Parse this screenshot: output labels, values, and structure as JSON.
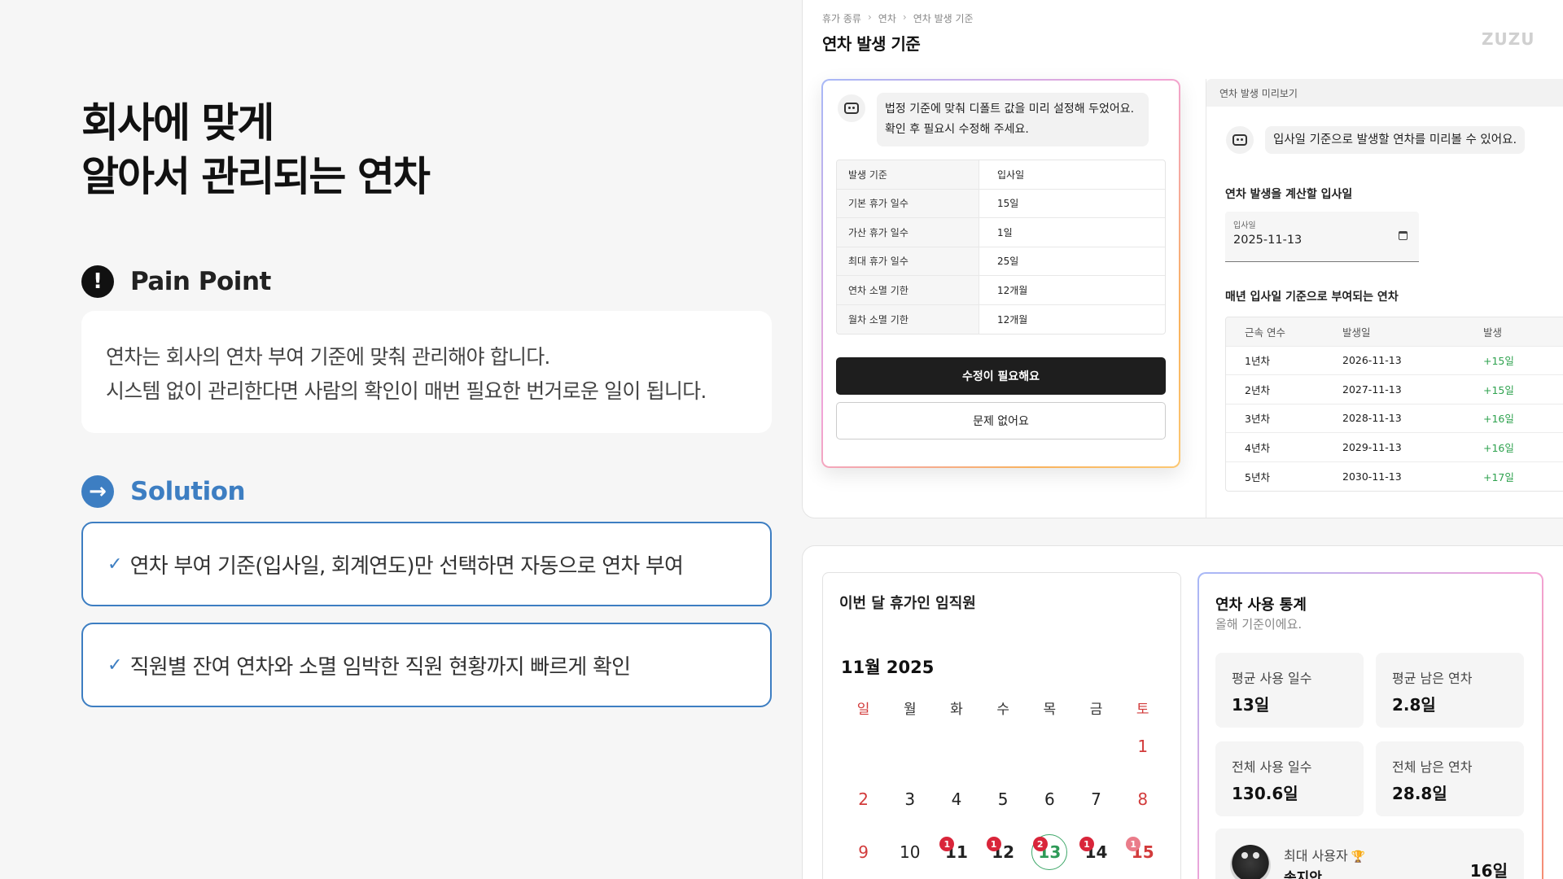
{
  "left": {
    "headline_line1": "회사에 맞게",
    "headline_line2": "알아서 관리되는 연차",
    "pain": {
      "icon": "exclamation-icon",
      "title": "Pain Point",
      "line1": "연차는 회사의 연차 부여 기준에 맞춰 관리해야 합니다.",
      "line2": "시스템 없이 관리한다면 사람의 확인이 매번 필요한 번거로운 일이 됩니다."
    },
    "solution": {
      "icon": "arrow-right-icon",
      "title": "Solution",
      "items": [
        "연차 부여 기준(입사일, 회계연도)만 선택하면 자동으로 연차 부여",
        "직원별 잔여 연차와 소멸 임박한 직원 현황까지 빠르게 확인"
      ]
    }
  },
  "app": {
    "breadcrumb": [
      "휴가 종류",
      "연차",
      "연차 발생 기준"
    ],
    "title": "연차 발생 기준",
    "logo": "ZUZU",
    "settings_card": {
      "bot_line1": "법정 기준에 맞춰 디폴트 값을 미리 설정해 두었어요.",
      "bot_line2": "확인 후 필요시 수정해 주세요.",
      "rows": [
        {
          "k": "발생 기준",
          "v": "입사일"
        },
        {
          "k": "기본 휴가 일수",
          "v": "15일"
        },
        {
          "k": "가산 휴가 일수",
          "v": "1일"
        },
        {
          "k": "최대 휴가 일수",
          "v": "25일"
        },
        {
          "k": "연차 소멸 기한",
          "v": "12개월"
        },
        {
          "k": "월차 소멸 기한",
          "v": "12개월"
        }
      ],
      "primary_button": "수정이 필요해요",
      "secondary_button": "문제 없어요"
    },
    "preview": {
      "header": "연차 발생 미리보기",
      "bot_text": "입사일 기준으로 발생할 연차를 미리볼 수 있어요.",
      "date_section_label": "연차 발생을 계산할 입사일",
      "date_field_label": "입사일",
      "date_field_value": "2025-11-13",
      "table_label": "매년 입사일 기준으로 부여되는 연차",
      "columns": [
        "근속 연수",
        "발생일",
        "발생"
      ],
      "rows": [
        {
          "year": "1년차",
          "date": "2026-11-13",
          "amount": "+15일"
        },
        {
          "year": "2년차",
          "date": "2027-11-13",
          "amount": "+15일"
        },
        {
          "year": "3년차",
          "date": "2028-11-13",
          "amount": "+16일"
        },
        {
          "year": "4년차",
          "date": "2029-11-13",
          "amount": "+16일"
        },
        {
          "year": "5년차",
          "date": "2030-11-13",
          "amount": "+17일"
        }
      ]
    },
    "calendar": {
      "title": "이번 달 휴가인 임직원",
      "month": "11월 2025",
      "weekdays": [
        "일",
        "월",
        "화",
        "수",
        "목",
        "금",
        "토"
      ],
      "days": [
        {
          "d": ""
        },
        {
          "d": ""
        },
        {
          "d": ""
        },
        {
          "d": ""
        },
        {
          "d": ""
        },
        {
          "d": ""
        },
        {
          "d": "1"
        },
        {
          "d": "2"
        },
        {
          "d": "3"
        },
        {
          "d": "4"
        },
        {
          "d": "5"
        },
        {
          "d": "6"
        },
        {
          "d": "7"
        },
        {
          "d": "8"
        },
        {
          "d": "9"
        },
        {
          "d": "10"
        },
        {
          "d": "11",
          "badge": "1"
        },
        {
          "d": "12",
          "badge": "1"
        },
        {
          "d": "13",
          "badge": "2",
          "today": true
        },
        {
          "d": "14",
          "badge": "1"
        },
        {
          "d": "15",
          "badge": "1"
        }
      ]
    },
    "stats": {
      "title": "연차 사용 통계",
      "subtitle": "올해 기준이에요.",
      "avg_used_label": "평균 사용 일수",
      "avg_used_value": "13일",
      "avg_left_label": "평균 남은 연차",
      "avg_left_value": "2.8일",
      "total_used_label": "전체 사용 일수",
      "total_used_value": "130.6일",
      "total_left_label": "전체 남은 연차",
      "total_left_value": "28.8일",
      "top_user_label": "최대 사용자",
      "top_user_name": "송지안",
      "top_user_value": "16일"
    }
  },
  "colors": {
    "solution_blue": "#3d7ec2",
    "holiday_red": "#d23b3b",
    "plus_green": "#2fa24f",
    "badge_red": "#d9253a"
  }
}
